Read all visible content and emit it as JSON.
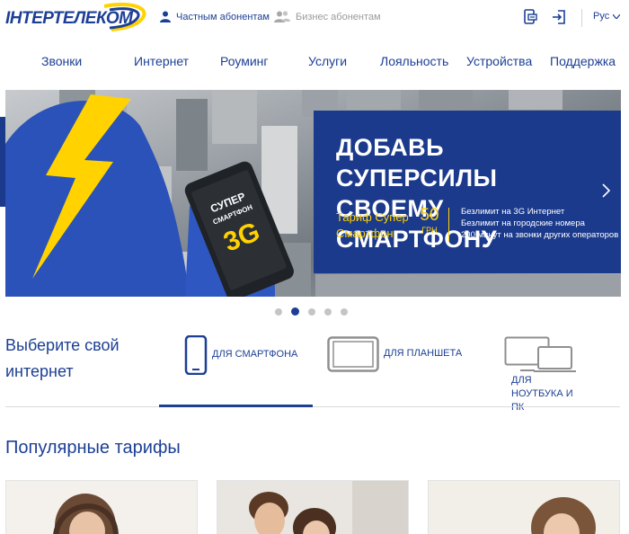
{
  "header": {
    "logo_text": "ІНТЕРТЕЛЕКОМ",
    "audience_private": "Частным абонентам",
    "audience_business": "Бизнес абонентам",
    "language": "Рус"
  },
  "nav": {
    "items": [
      {
        "label": "Звонки"
      },
      {
        "label": "Интернет"
      },
      {
        "label": "Роуминг"
      },
      {
        "label": "Услуги"
      },
      {
        "label": "Лояльность"
      },
      {
        "label": "Устройства"
      },
      {
        "label": "Поддержка"
      }
    ]
  },
  "banner": {
    "title": "ДОБАВЬ СУПЕРСИЛЫ СВОЕМУ СМАРТФОНУ",
    "tariff_name": "Тариф Супер Смартфон",
    "price": "50",
    "currency": "ГРН",
    "features": [
      "Безлимит на 3G Интернет",
      "Безлимит на городские номера",
      "200 минут на звонки других операторов"
    ],
    "phone_text_top": "СУПЕР",
    "phone_text_mid": "СМАРТФОН",
    "phone_text_big": "3G",
    "active_slide": 2,
    "slide_count": 5
  },
  "internet": {
    "title": "Выберите свой интернет",
    "devices": [
      {
        "label": "ДЛЯ СМАРТФОНА",
        "icon": "smartphone-icon",
        "active": true
      },
      {
        "label": "ДЛЯ ПЛАНШЕТА",
        "icon": "tablet-icon",
        "active": false
      },
      {
        "label": "ДЛЯ НОУТБУКА И ПК",
        "icon": "laptop-pc-icon",
        "active": false
      }
    ]
  },
  "popular": {
    "title": "Популярные тарифы"
  },
  "colors": {
    "brand_blue": "#1c3f94",
    "accent_yellow": "#ffd200",
    "muted_gray": "#9a9a9a"
  }
}
